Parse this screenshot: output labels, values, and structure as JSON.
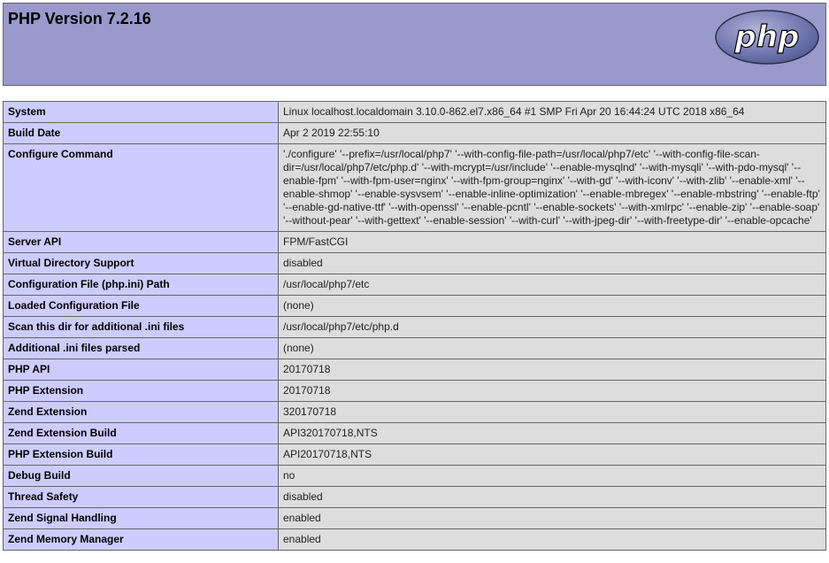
{
  "header": {
    "title": "PHP Version 7.2.16",
    "logo_text": "php",
    "bg_color": "#9999cc"
  },
  "rows": [
    {
      "label": "System",
      "value": "Linux localhost.localdomain 3.10.0-862.el7.x86_64 #1 SMP Fri Apr 20 16:44:24 UTC 2018 x86_64"
    },
    {
      "label": "Build Date",
      "value": "Apr 2 2019 22:55:10"
    },
    {
      "label": "Configure Command",
      "value": "'./configure' '--prefix=/usr/local/php7' '--with-config-file-path=/usr/local/php7/etc' '--with-config-file-scan-dir=/usr/local/php7/etc/php.d' '--with-mcrypt=/usr/include' '--enable-mysqlnd' '--with-mysqli' '--with-pdo-mysql' '--enable-fpm' '--with-fpm-user=nginx' '--with-fpm-group=nginx' '--with-gd' '--with-iconv' '--with-zlib' '--enable-xml' '--enable-shmop' '--enable-sysvsem' '--enable-inline-optimization' '--enable-mbregex' '--enable-mbstring' '--enable-ftp' '--enable-gd-native-ttf' '--with-openssl' '--enable-pcntl' '--enable-sockets' '--with-xmlrpc' '--enable-zip' '--enable-soap' '--without-pear' '--with-gettext' '--enable-session' '--with-curl' '--with-jpeg-dir' '--with-freetype-dir' '--enable-opcache'"
    },
    {
      "label": "Server API",
      "value": "FPM/FastCGI"
    },
    {
      "label": "Virtual Directory Support",
      "value": "disabled"
    },
    {
      "label": "Configuration File (php.ini) Path",
      "value": "/usr/local/php7/etc"
    },
    {
      "label": "Loaded Configuration File",
      "value": "(none)"
    },
    {
      "label": "Scan this dir for additional .ini files",
      "value": "/usr/local/php7/etc/php.d"
    },
    {
      "label": "Additional .ini files parsed",
      "value": "(none)"
    },
    {
      "label": "PHP API",
      "value": "20170718"
    },
    {
      "label": "PHP Extension",
      "value": "20170718"
    },
    {
      "label": "Zend Extension",
      "value": "320170718"
    },
    {
      "label": "Zend Extension Build",
      "value": "API320170718,NTS"
    },
    {
      "label": "PHP Extension Build",
      "value": "API20170718,NTS"
    },
    {
      "label": "Debug Build",
      "value": "no"
    },
    {
      "label": "Thread Safety",
      "value": "disabled"
    },
    {
      "label": "Zend Signal Handling",
      "value": "enabled"
    },
    {
      "label": "Zend Memory Manager",
      "value": "enabled"
    }
  ]
}
